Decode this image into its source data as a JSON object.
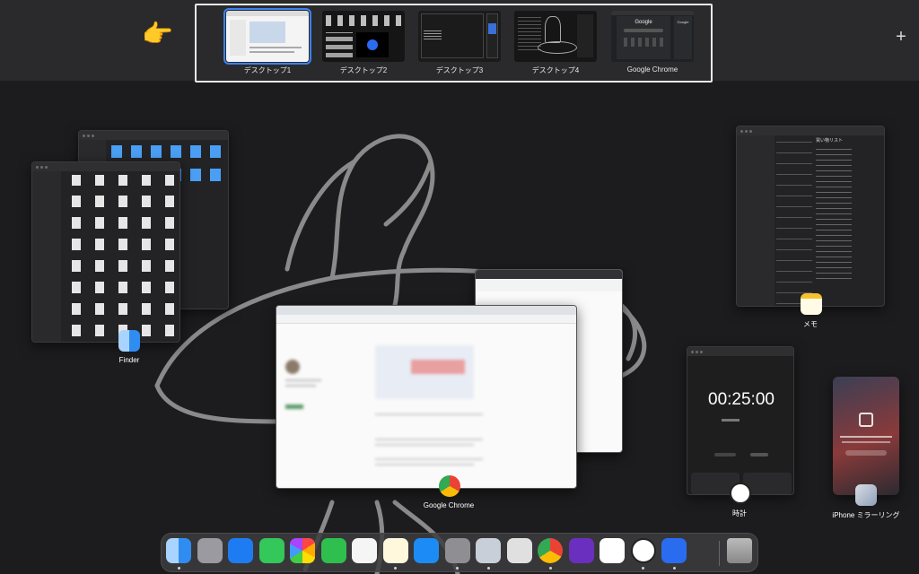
{
  "spaces": [
    {
      "label": "デスクトップ1",
      "active": true
    },
    {
      "label": "デスクトップ2",
      "active": false
    },
    {
      "label": "デスクトップ3",
      "active": false
    },
    {
      "label": "デスクトップ4",
      "active": false
    },
    {
      "label": "Google Chrome",
      "active": false
    }
  ],
  "pointer_emoji": "👉",
  "add_space_label": "+",
  "thumb_google_text": "Google",
  "windows": {
    "finder": {
      "label": "Finder"
    },
    "chrome": {
      "label": "Google Chrome"
    },
    "memo": {
      "label": "メモ"
    },
    "clock": {
      "label": "時計",
      "timer": "00:25:00"
    },
    "iphone": {
      "label": "iPhone ミラーリング"
    }
  },
  "memo_content": {
    "heading": "買い物リスト"
  },
  "dock": {
    "items": [
      {
        "name": "finder-icon",
        "color": "#2f8cf0",
        "dot": true
      },
      {
        "name": "launchpad-icon",
        "color": "#9a9aa0",
        "dot": false
      },
      {
        "name": "safari-icon",
        "color": "#1e7cf2",
        "dot": false
      },
      {
        "name": "messages-icon",
        "color": "#34c759",
        "dot": false
      },
      {
        "name": "photos-icon",
        "color": "#ffffff",
        "dot": false
      },
      {
        "name": "facetime-icon",
        "color": "#2fbf4f",
        "dot": false
      },
      {
        "name": "reminders-icon",
        "color": "#f5f5f5",
        "dot": false
      },
      {
        "name": "notes-icon",
        "color": "#fff8dc",
        "dot": true
      },
      {
        "name": "app-store-icon",
        "color": "#1d8bf5",
        "dot": false
      },
      {
        "name": "system-settings-icon",
        "color": "#8e8e93",
        "dot": true
      },
      {
        "name": "iphone-mirroring-icon",
        "color": "#c9cfd8",
        "dot": true
      },
      {
        "name": "calculator-icon",
        "color": "#e0e0e0",
        "dot": false
      },
      {
        "name": "chrome-icon",
        "color": "#ffffff",
        "dot": true
      },
      {
        "name": "affinity-designer-icon",
        "color": "#6b2fbf",
        "dot": false
      },
      {
        "name": "freeform-icon",
        "color": "#ffffff",
        "dot": false
      },
      {
        "name": "clock-icon",
        "color": "#ffffff",
        "dot": true
      },
      {
        "name": "filmora-icon",
        "color": "#2a6cf0",
        "dot": true
      },
      {
        "name": "trash-icon",
        "color": "#cfcfcf",
        "dot": false
      }
    ]
  }
}
